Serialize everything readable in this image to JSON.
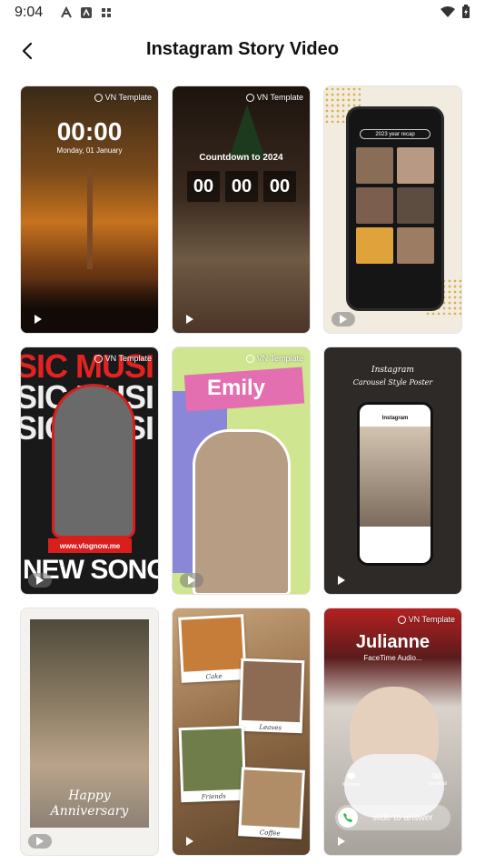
{
  "status_bar": {
    "time": "9:04"
  },
  "header": {
    "title": "Instagram Story Video",
    "back_icon": "chevron-left-icon"
  },
  "badge_label": "VN Template",
  "cards": [
    {
      "clock": "00:00",
      "date": "Monday, 01 January"
    },
    {
      "countdown_label": "Countdown to 2024",
      "boxes": [
        "00",
        "00",
        "00"
      ]
    },
    {
      "search_text": "2023 year recap"
    },
    {
      "music_text": "SIC MUSI",
      "url": "www.vlognow.me",
      "headline": "NEW SONG"
    },
    {
      "name": "Emily"
    },
    {
      "title": "Instagram",
      "subtitle": "Carousel Style Poster",
      "app_name": "Instagram"
    },
    {
      "line1": "Happy",
      "line2": "Anniversary"
    },
    {
      "captions": [
        "Cake",
        "Leaves",
        "Friends",
        "Coffee"
      ]
    },
    {
      "name": "Julianne",
      "subtitle": "FaceTime Audio...",
      "left_action": "Message",
      "right_action": "Voicemail",
      "slide_text": "slide to answer"
    }
  ]
}
